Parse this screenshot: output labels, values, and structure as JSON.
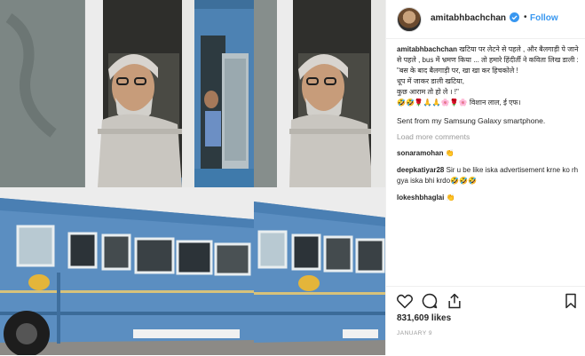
{
  "post": {
    "username": "amitabhbachchan",
    "follow_label": "Follow",
    "dot": "•",
    "caption_user": "amitabhbachchan",
    "caption_text": "खटिया पर लेटने से पहले , और बैलगाड़ी पे जाने से पहले , bus में भ्रमण किया ... तो हमारे हिंदीर्ती ने कविता लिख डाली : \"बस के बाद बैलगाड़ी पर, खा खा कर हिचकोले !",
    "caption_line2": "धूप में जाकर डाली खटिया,",
    "caption_line3": "कुछ आराम तो हो ले । !\"",
    "caption_line4": "🤣🤣🌹🙏🙏🌸🌹🌸 विशान लाल, ई एफ।",
    "sent_from": "Sent from my Samsung Galaxy smartphone.",
    "load_more": "Load more comments",
    "comments": [
      {
        "user": "sonaramohan",
        "text": "👏"
      },
      {
        "user": "deepkatiyar28",
        "text": "Sir u be like iska advertisement krne ko rh gya iska bhi krdo🤣🤣🤣"
      },
      {
        "user": "lokeshbhaglai",
        "text": "👏"
      }
    ],
    "likes": "831,609 likes",
    "date": "JANUARY 9"
  },
  "icons": {
    "heart": "heart-icon",
    "comment": "comment-icon",
    "share": "share-icon",
    "bookmark": "bookmark-icon",
    "verified": "verified-badge-icon"
  },
  "colors": {
    "follow": "#3897f0",
    "bus_blue": "#5b8ec1",
    "text": "#262626",
    "muted": "#999999"
  }
}
